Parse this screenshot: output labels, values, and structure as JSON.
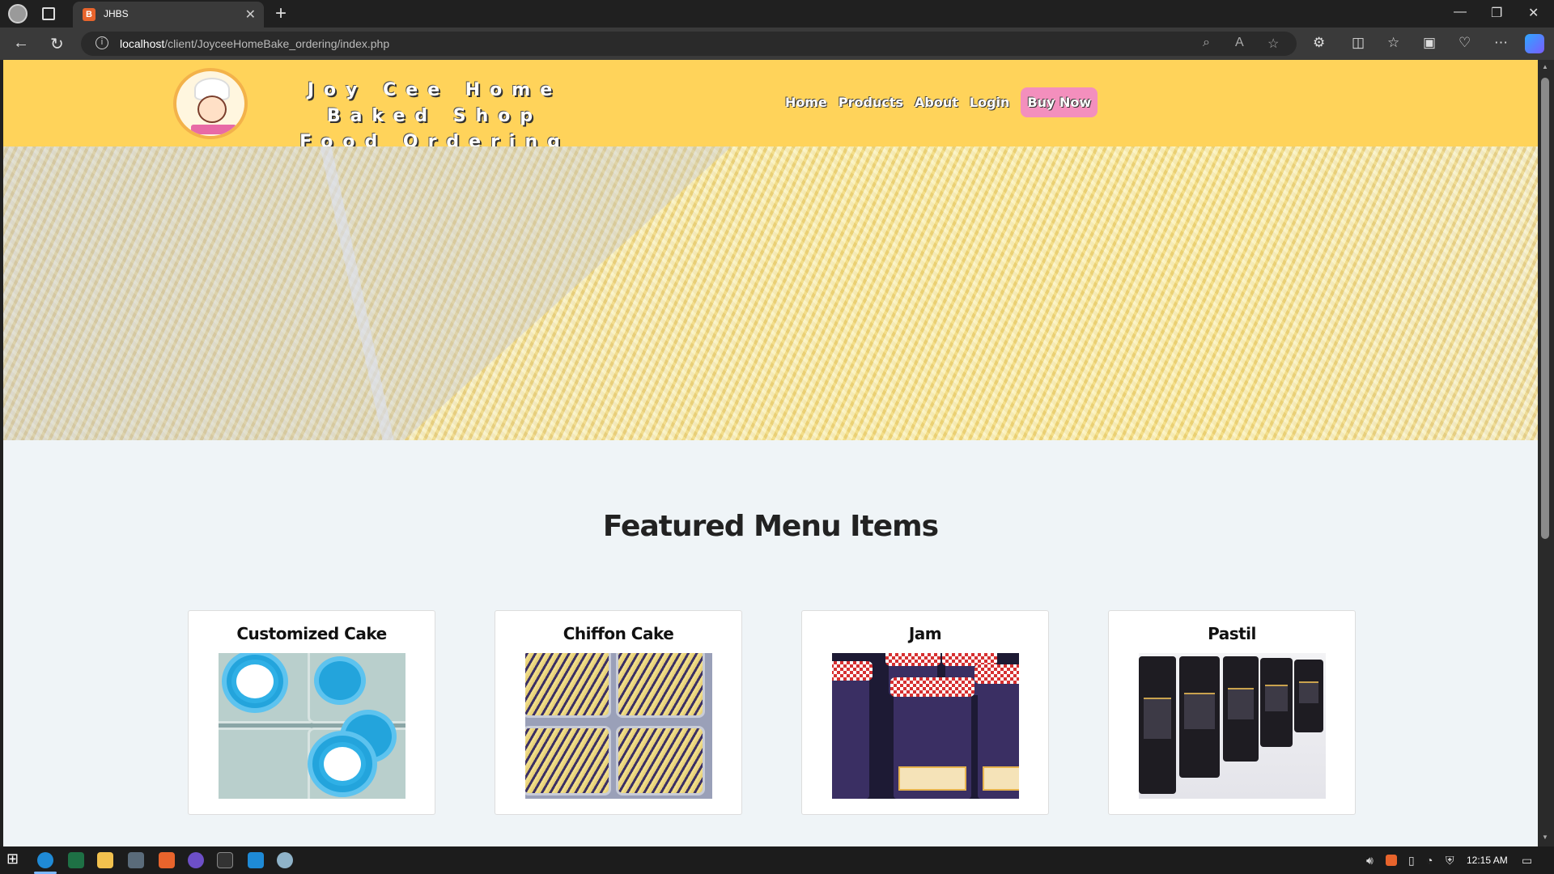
{
  "browser": {
    "tab_title": "JHBS",
    "tab_favicon": "B",
    "url_host": "localhost",
    "url_path": "/client/JoyceeHomeBake_ordering/index.php"
  },
  "site": {
    "title_line1": "Joy Cee Home Baked Shop",
    "title_line2": "Food Ordering",
    "nav": {
      "home": "Home",
      "products": "Products",
      "about": "About",
      "login": "Login",
      "buy_now": "Buy Now"
    }
  },
  "featured": {
    "heading": "Featured Menu Items",
    "items": [
      {
        "name": "Customized Cake"
      },
      {
        "name": "Chiffon Cake"
      },
      {
        "name": "Jam"
      },
      {
        "name": "Pastil"
      }
    ]
  },
  "taskbar": {
    "time": "12:15 AM"
  },
  "colors": {
    "header_bg": "#ffd35a",
    "buy_now_bg": "#f38fbd",
    "page_bg": "#eff4f7"
  }
}
